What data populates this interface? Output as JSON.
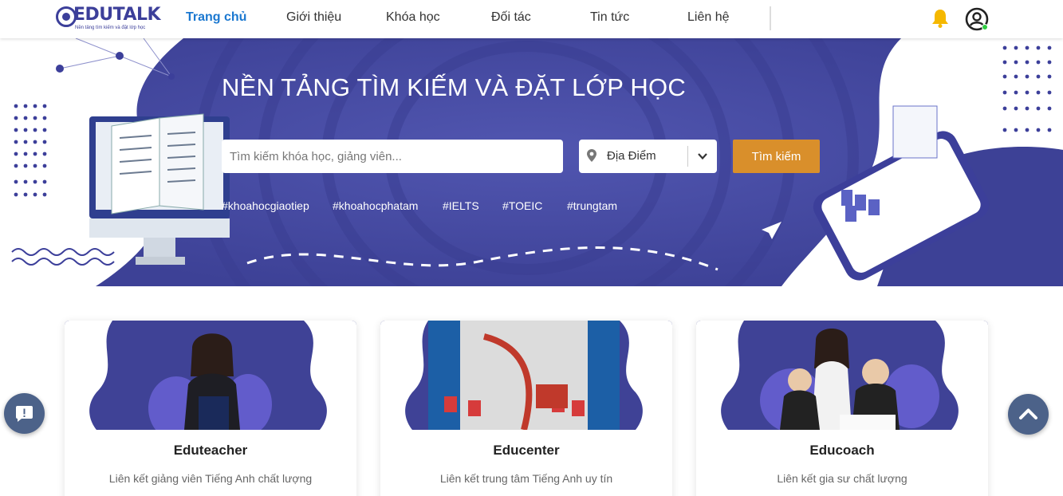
{
  "header": {
    "logo_text": "EDUTALK",
    "logo_tagline": "Nền tảng tìm kiếm và đặt lớp học",
    "nav": [
      {
        "label": "Trang chủ",
        "active": true
      },
      {
        "label": "Giới thiệu",
        "active": false
      },
      {
        "label": "Khóa học",
        "active": false
      },
      {
        "label": "Đối tác",
        "active": false
      },
      {
        "label": "Tin tức",
        "active": false
      },
      {
        "label": "Liên hệ",
        "active": false
      }
    ],
    "icons": {
      "notification": "bell-icon",
      "account": "user-circle-icon"
    }
  },
  "hero": {
    "title": "NỀN TẢNG TÌM KIẾM VÀ ĐẶT LỚP HỌC",
    "search_placeholder": "Tìm kiếm khóa học, giảng viên...",
    "location_value": "Địa Điểm",
    "search_button": "Tìm kiếm",
    "hashtags": [
      "#khoahocgiaotiep",
      "#khoahocphatam",
      "#IELTS",
      "#TOEIC",
      "#trungtam"
    ]
  },
  "cards": [
    {
      "title": "Eduteacher",
      "description": "Liên kết giảng viên Tiếng Anh chất lượng"
    },
    {
      "title": "Educenter",
      "description": "Liên kết trung tâm Tiếng Anh uy tín"
    },
    {
      "title": "Educoach",
      "description": "Liên kết gia sư chất lượng"
    }
  ],
  "colors": {
    "brand": "#3c3f9a",
    "nav_active": "#1b78d0",
    "hero_bg": "#4a4fa8",
    "search_button": "#d98f2b",
    "notification_bell": "#f5b800",
    "online_dot": "#2ecc40",
    "float_button": "#4c6289"
  },
  "floating": {
    "chat_icon": "chat-alert-icon",
    "scroll_top_icon": "chevron-up-icon"
  }
}
